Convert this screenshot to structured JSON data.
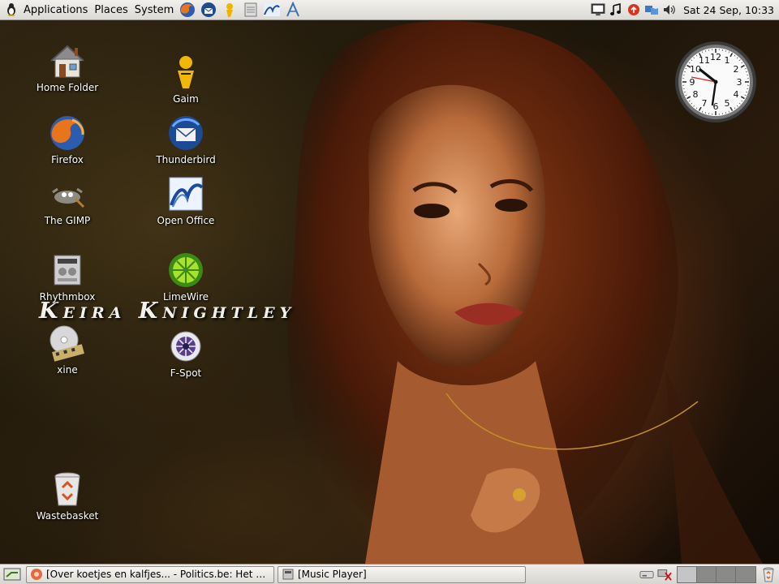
{
  "top_panel": {
    "menus": [
      "Applications",
      "Places",
      "System"
    ],
    "launchers": [
      "firefox-icon",
      "thunderbird-icon",
      "gaim-icon",
      "notes-icon",
      "openoffice-icon",
      "aptana-icon"
    ],
    "clock": "Sat 24 Sep, 10:33"
  },
  "desktop": {
    "wallpaper_title": "Keira Knightley",
    "icons": [
      {
        "label": "Home Folder"
      },
      {
        "label": "Gaim"
      },
      {
        "label": "Firefox"
      },
      {
        "label": "Thunderbird"
      },
      {
        "label": "The GIMP"
      },
      {
        "label": "Open Office"
      },
      {
        "label": "Rhythmbox"
      },
      {
        "label": "LimeWire"
      },
      {
        "label": "xine"
      },
      {
        "label": "F-Spot"
      },
      {
        "label": "Wastebasket"
      }
    ]
  },
  "bottom_panel": {
    "tasks": [
      {
        "label": "[Over koetjes en kalfjes... - Politics.be: Het g..."
      },
      {
        "label": "[Music Player]"
      }
    ],
    "workspaces": 4,
    "active_workspace": 1
  },
  "colors": {
    "panel": "#dcdad5",
    "label_text": "#ffffff",
    "clock_second_hand": "#e02020"
  }
}
